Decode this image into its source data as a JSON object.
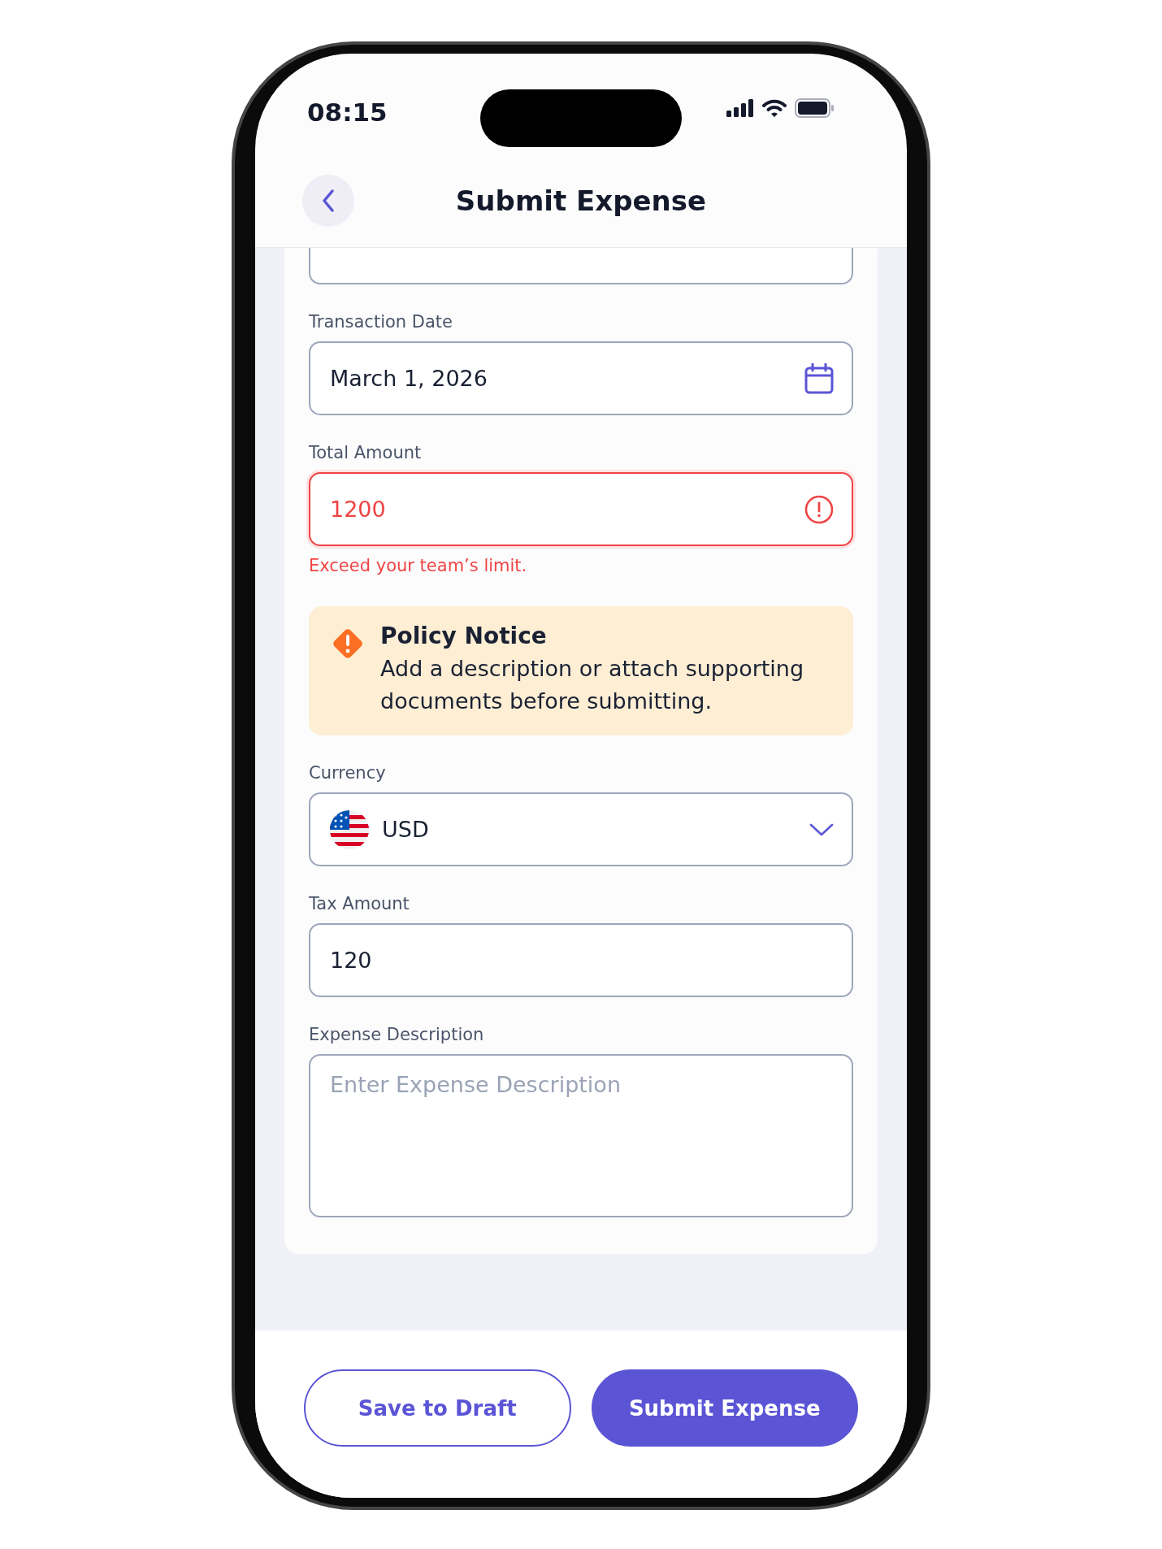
{
  "status_bar": {
    "time": "08:15"
  },
  "header": {
    "title": "Submit Expense"
  },
  "fields": [
    {
      "kind": "text"
    },
    {
      "kind": "date",
      "label": "Transaction Date",
      "value": "March 1, 2026"
    },
    {
      "kind": "amount",
      "label": "Total Amount",
      "value": "1200",
      "error": "Exceed your team’s limit."
    },
    {
      "kind": "notice",
      "title": "Policy Notice",
      "text": "Add a description or attach supporting documents before submitting."
    },
    {
      "kind": "select",
      "label": "Currency",
      "value": "USD"
    },
    {
      "kind": "text",
      "label": "Tax Amount",
      "value": "120"
    },
    {
      "kind": "textarea",
      "label": "Expense Description",
      "placeholder": "Enter Expense Description"
    }
  ],
  "buttons": [
    {
      "label": "Save to Draft",
      "kind": "secondary"
    },
    {
      "label": "Submit Expense",
      "kind": "primary"
    }
  ]
}
